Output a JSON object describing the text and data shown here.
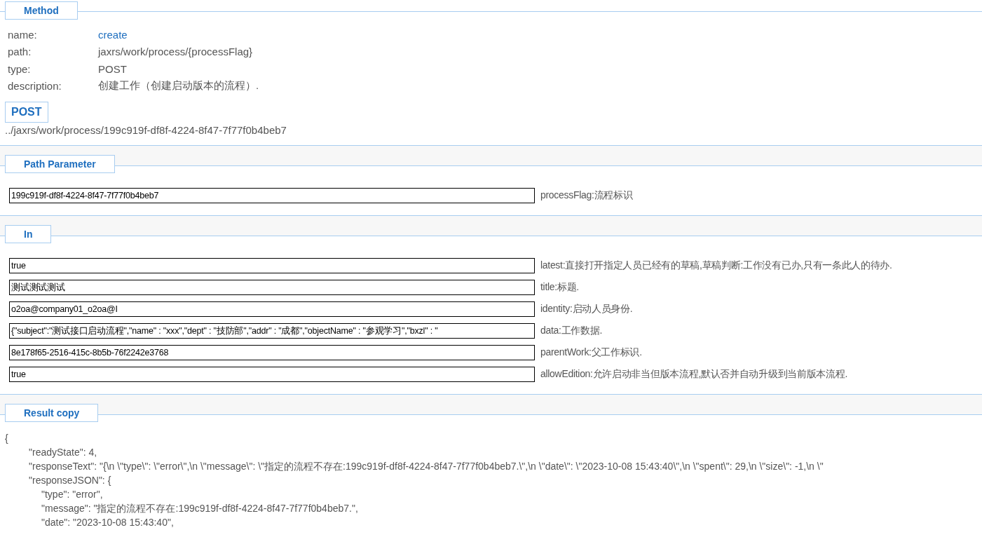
{
  "method": {
    "title": "Method",
    "fields": [
      {
        "label": "name:",
        "value": "create",
        "kind": "link"
      },
      {
        "label": "path:",
        "value": "jaxrs/work/process/{processFlag}",
        "kind": "text"
      },
      {
        "label": "type:",
        "value": "POST",
        "kind": "text"
      },
      {
        "label": "description:",
        "value": "创建工作（创建启动版本的流程）.",
        "kind": "text"
      }
    ],
    "badge": "POST",
    "url": "../jaxrs/work/process/199c919f-df8f-4224-8f47-7f77f0b4beb7"
  },
  "path_parameter": {
    "title": "Path Parameter",
    "params": [
      {
        "value": "199c919f-df8f-4224-8f47-7f77f0b4beb7",
        "description": "processFlag:流程标识"
      }
    ]
  },
  "in": {
    "title": "In",
    "params": [
      {
        "value": "true",
        "description": "latest:直接打开指定人员已经有的草稿,草稿判断:工作没有已办,只有一条此人的待办."
      },
      {
        "value": "测试测试测试",
        "description": "title:标题."
      },
      {
        "value": "o2oa@company01_o2oa@I",
        "description": "identity:启动人员身份."
      },
      {
        "value": "{\"subject\":\"测试接口启动流程\",\"name\" : \"xxx\",\"dept\" : \"技防部\",\"addr\" : \"成都\",\"objectName\" : \"参观学习\",\"bxzl\" : \"",
        "description": "data:工作数据."
      },
      {
        "value": "8e178f65-2516-415c-8b5b-76f2242e3768",
        "description": "parentWork:父工作标识."
      },
      {
        "value": "true",
        "description": "allowEdition:允许启动非当但版本流程,默认否并自动升级到当前版本流程."
      }
    ]
  },
  "result": {
    "title": "Result copy",
    "lines": [
      {
        "text": "{",
        "children": [
          {
            "text": "\"readyState\": 4,"
          },
          {
            "text": "\"responseText\": \"{\\n  \\\"type\\\": \\\"error\\\",\\n  \\\"message\\\": \\\"指定的流程不存在:199c919f-df8f-4224-8f47-7f77f0b4beb7.\\\",\\n  \\\"date\\\": \\\"2023-10-08 15:43:40\\\",\\n  \\\"spent\\\": 29,\\n  \\\"size\\\": -1,\\n  \\\""
          },
          {
            "text": "\"responseJSON\": {",
            "children": [
              {
                "text": "\"type\": \"error\","
              },
              {
                "text": "\"message\": \"指定的流程不存在:199c919f-df8f-4224-8f47-7f77f0b4beb7.\","
              },
              {
                "text": "\"date\": \"2023-10-08 15:43:40\","
              }
            ]
          }
        ]
      }
    ]
  }
}
